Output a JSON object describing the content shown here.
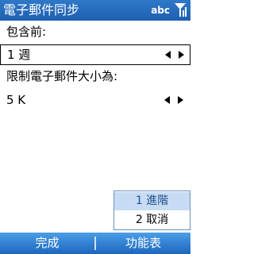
{
  "title_bar": {
    "title": "電子郵件同步",
    "input_mode": "abc",
    "signal_icon": "signal-strength-icon"
  },
  "form": {
    "include_before_label": "包含前:",
    "include_before_value": "1 週",
    "size_limit_label": "限制電子郵件大小為:",
    "size_limit_value": "5 K"
  },
  "menu": {
    "items": [
      {
        "label": "1 進階",
        "selected": true
      },
      {
        "label": "2 取消",
        "selected": false
      }
    ]
  },
  "softkeys": {
    "left": "完成",
    "right": "功能表"
  },
  "colors": {
    "title_bar": "#1f5fb0",
    "softkey_bar": "#1d67bf",
    "menu_highlight": "#c7dcf4"
  }
}
